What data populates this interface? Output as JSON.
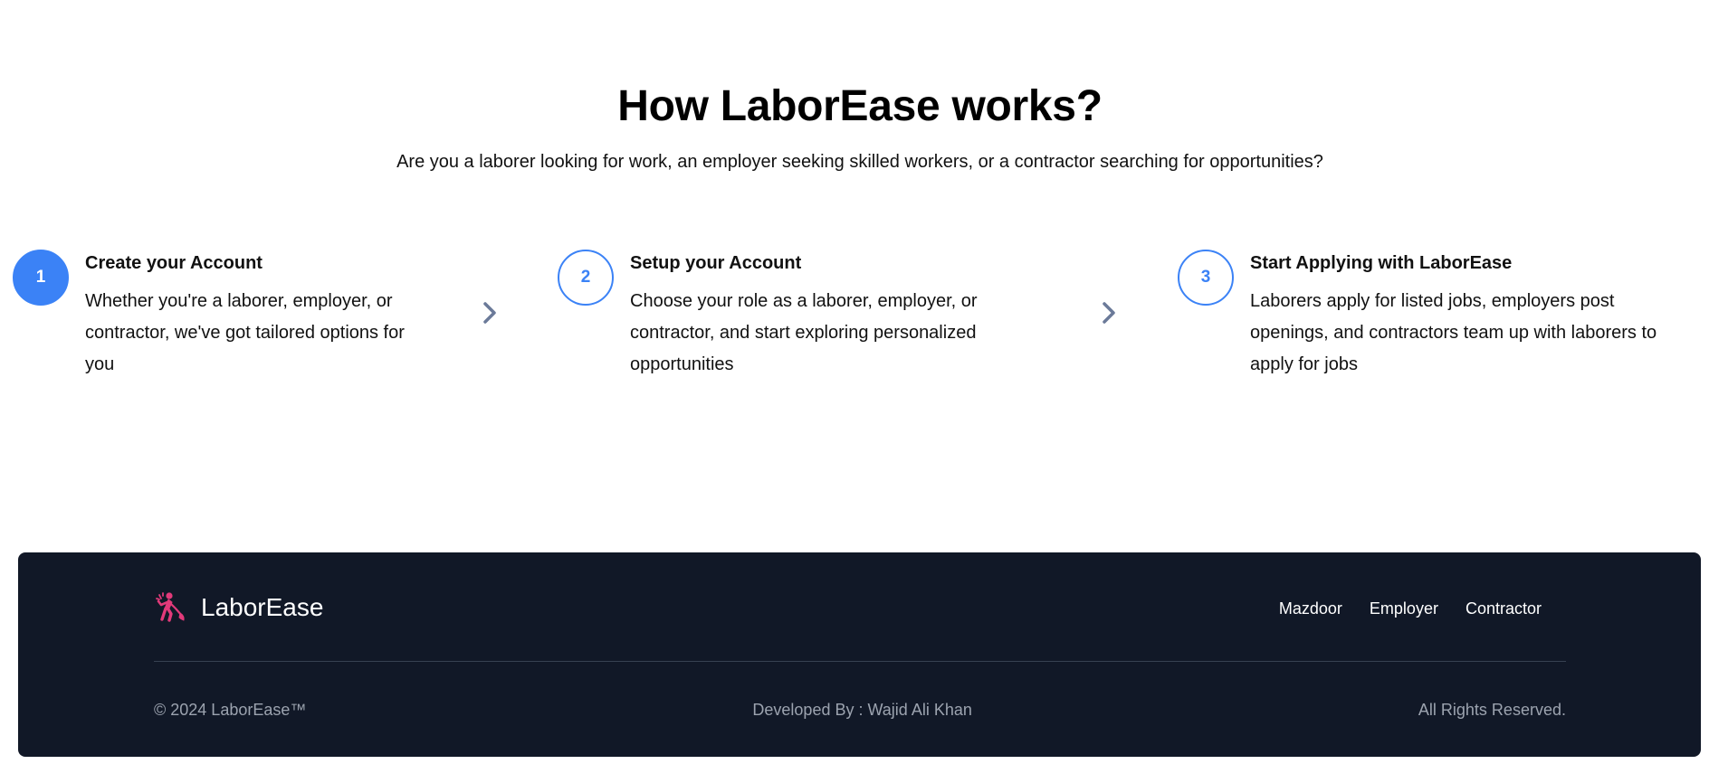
{
  "how_it_works": {
    "title": "How LaborEase works?",
    "subtitle": "Are you a laborer looking for work, an employer seeking skilled workers, or a contractor searching for opportunities?",
    "steps": [
      {
        "number": "1",
        "title": "Create your Account",
        "description": "Whether you're a laborer, employer, or contractor, we've got tailored options for you",
        "active": true
      },
      {
        "number": "2",
        "title": "Setup your Account",
        "description": "Choose your role as a laborer, employer, or contractor, and start exploring personalized opportunities",
        "active": false
      },
      {
        "number": "3",
        "title": "Start Applying with LaborEase",
        "description": "Laborers apply for listed jobs, employers post openings, and contractors team up with laborers to apply for jobs",
        "active": false
      }
    ],
    "arrow_icon": "chevron-right-icon"
  },
  "footer": {
    "brand_name": "LaborEase",
    "logo_icon": "laborer-logo-icon",
    "nav_links": [
      "Mazdoor",
      "Employer",
      "Contractor"
    ],
    "copyright": "© 2024 LaborEase™",
    "developer": "Developed By : Wajid Ali Khan",
    "rights": "All Rights Reserved."
  },
  "colors": {
    "accent": "#3b82f6",
    "footer_bg": "#111827",
    "logo": "#e23a7a",
    "arrow": "#6b7a99"
  }
}
